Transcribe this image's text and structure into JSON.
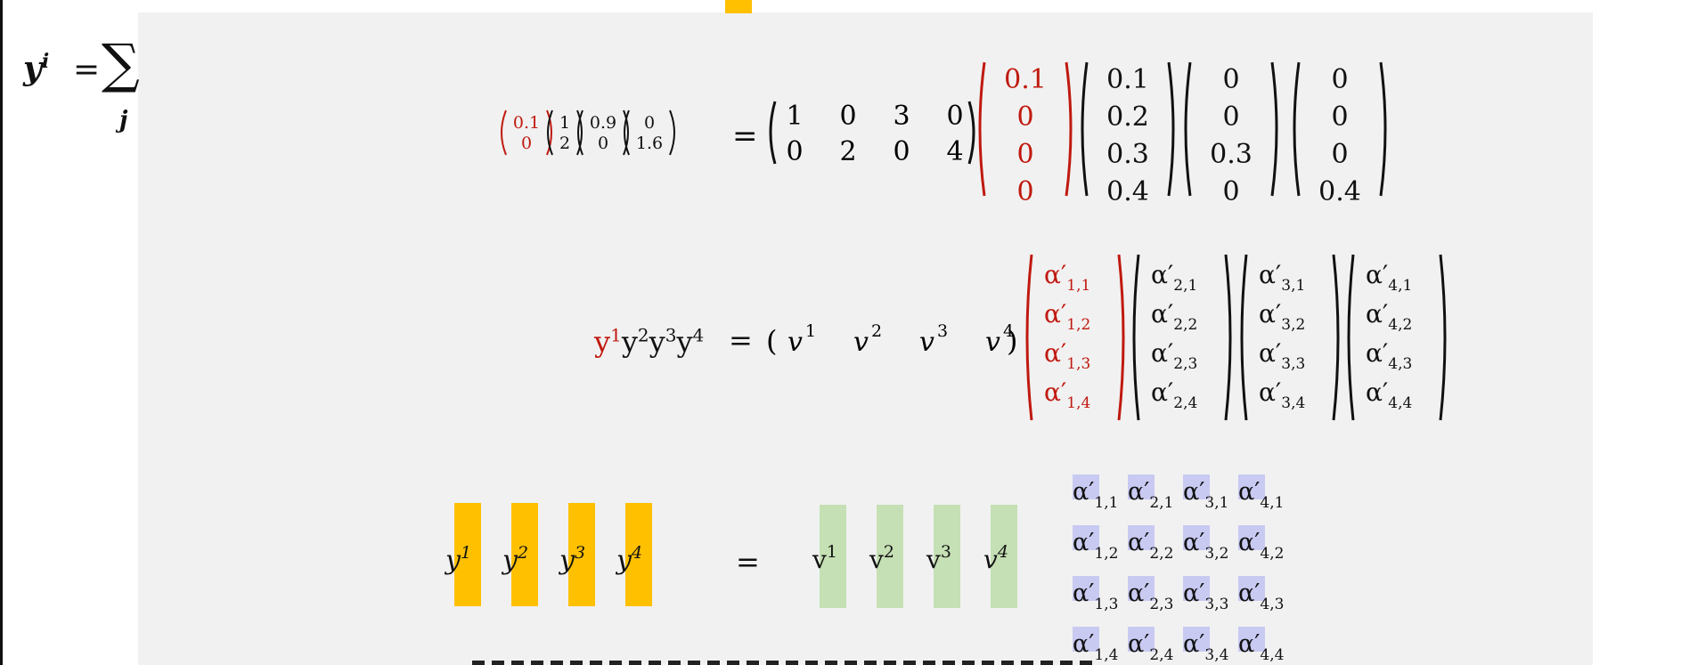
{
  "left_formula": {
    "lhs": "y",
    "lhs_sup": "i",
    "eq": "=",
    "sum": "∑",
    "index": "j"
  },
  "row1": {
    "lhs_vectors": [
      [
        "0.1",
        "0"
      ],
      [
        "1",
        "2"
      ],
      [
        "0.9",
        "0"
      ],
      [
        "0",
        "1.6"
      ]
    ],
    "eq": "=",
    "matrix": [
      [
        "1",
        "0",
        "3",
        "0"
      ],
      [
        "0",
        "2",
        "0",
        "4"
      ]
    ],
    "columns": [
      [
        "0.1",
        "0",
        "0",
        "0"
      ],
      [
        "0.1",
        "0.2",
        "0.3",
        "0.4"
      ],
      [
        "0",
        "0",
        "0.3",
        "0"
      ],
      [
        "0",
        "0",
        "0",
        "0.4"
      ]
    ]
  },
  "row2": {
    "lhs": [
      "y",
      "y",
      "y",
      "y"
    ],
    "lhs_sups": [
      "1",
      "2",
      "3",
      "4"
    ],
    "eq": "=",
    "v_terms": [
      "v",
      "v",
      "v",
      "v"
    ],
    "v_sups": [
      "1",
      "2",
      "3",
      "4"
    ],
    "alpha_symbol": "α′",
    "alpha_columns": [
      [
        "1,1",
        "1,2",
        "1,3",
        "1,4"
      ],
      [
        "2,1",
        "2,2",
        "2,3",
        "2,4"
      ],
      [
        "3,1",
        "3,2",
        "3,3",
        "3,4"
      ],
      [
        "4,1",
        "4,2",
        "4,3",
        "4,4"
      ]
    ]
  },
  "row3": {
    "y_labels": [
      "y",
      "y",
      "y",
      "y"
    ],
    "y_sups": [
      "1",
      "2",
      "3",
      "4"
    ],
    "eq": "=",
    "v_labels": [
      "v",
      "v",
      "v",
      "v"
    ],
    "v_sups": [
      "1",
      "2",
      "3",
      "4"
    ],
    "alpha_grid": [
      [
        "1,1",
        "2,1",
        "3,1",
        "4,1"
      ],
      [
        "1,2",
        "2,2",
        "3,2",
        "4,2"
      ],
      [
        "1,3",
        "2,3",
        "3,3",
        "4,3"
      ],
      [
        "1,4",
        "2,4",
        "3,4",
        "4,4"
      ]
    ]
  },
  "colors": {
    "accent_red": "#c0190f",
    "yellow": "#ffc000",
    "green": "#c5e0b4",
    "chip": "#c9caf2",
    "slide_bg": "#f1f1f1"
  }
}
